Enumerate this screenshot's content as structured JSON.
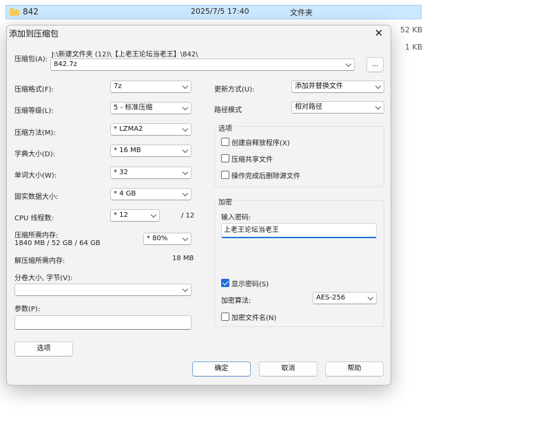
{
  "background": {
    "selected_row": {
      "name": "842",
      "date": "2025/7/5 17:40",
      "type": "文件夹"
    },
    "sizes": [
      "52 KB",
      "1 KB"
    ]
  },
  "dialog": {
    "title": "添加到压缩包",
    "close_glyph": "✕",
    "archive": {
      "label": "压缩包(A):",
      "path": "J:\\新建文件夹 (12)\\【上老王论坛当老王】\\842\\",
      "filename": "842.7z",
      "browse_label": "..."
    },
    "left": {
      "format": {
        "label": "压缩格式(F):",
        "value": "7z"
      },
      "level": {
        "label": "压缩等级(L):",
        "value": "5 - 标准压缩"
      },
      "method": {
        "label": "压缩方法(M):",
        "value": "* LZMA2"
      },
      "dict": {
        "label": "字典大小(D):",
        "value": "* 16 MB"
      },
      "word": {
        "label": "单词大小(W):",
        "value": "* 32"
      },
      "solid": {
        "label": "固实数据大小:",
        "value": "* 4 GB"
      },
      "threads": {
        "label": "CPU 线程数:",
        "value": "* 12",
        "max": "/ 12"
      },
      "mem_compress": {
        "label": "压缩所需内存:",
        "detail": "1840 MB / 52 GB / 64 GB",
        "value": "* 80%"
      },
      "mem_decompress": {
        "label": "解压缩所需内存:",
        "value": "18 MB"
      },
      "split": {
        "label": "分卷大小, 字节(V):",
        "value": ""
      },
      "params": {
        "label": "参数(P):",
        "value": ""
      }
    },
    "right": {
      "update": {
        "label": "更新方式(U):",
        "value": "添加并替换文件"
      },
      "path_mode": {
        "label": "路径模式",
        "value": "相对路径"
      },
      "options": {
        "title": "选项",
        "sfx": {
          "label": "创建自释放程序(X)",
          "checked": false
        },
        "shared": {
          "label": "压缩共享文件",
          "checked": false
        },
        "delete": {
          "label": "操作完成后删除源文件",
          "checked": false
        }
      },
      "encryption": {
        "title": "加密",
        "password_label": "输入密码:",
        "password_value": "上老王论坛当老王",
        "show_pwd": {
          "label": "显示密码(S)",
          "checked": true
        },
        "method_label": "加密算法:",
        "method_value": "AES-256",
        "encrypt_names": {
          "label": "加密文件名(N)",
          "checked": false
        }
      }
    },
    "buttons": {
      "options": "选项",
      "ok": "确定",
      "cancel": "取消",
      "help": "帮助"
    }
  }
}
